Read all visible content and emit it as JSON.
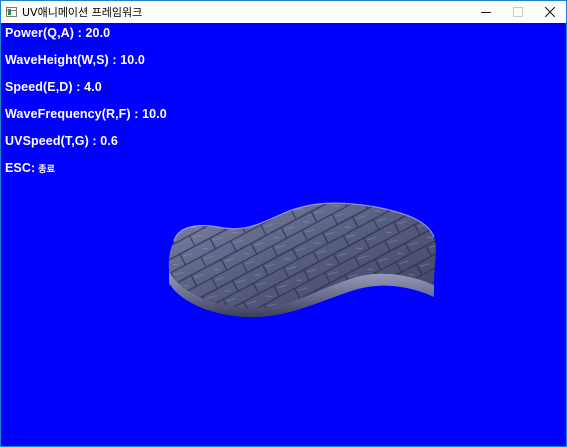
{
  "window": {
    "title": "UV애니메이션 프레임워크",
    "controls": {
      "minimize_icon": "minimize-icon",
      "maximize_icon": "maximize-icon",
      "close_icon": "close-icon"
    }
  },
  "viewport": {
    "background_color": "#0000ff",
    "hud": {
      "power": "Power(Q,A) : 20.0",
      "wave_height": "WaveHeight(W,S) : 10.0",
      "speed": "Speed(E,D) : 4.0",
      "wave_frequency": "WaveFrequency(R,F) : 10.0",
      "uv_speed": "UVSpeed(T,G) : 0.6",
      "esc_key": "ESC:",
      "esc_action": "종료"
    },
    "mesh_texture": "stone-tile"
  }
}
